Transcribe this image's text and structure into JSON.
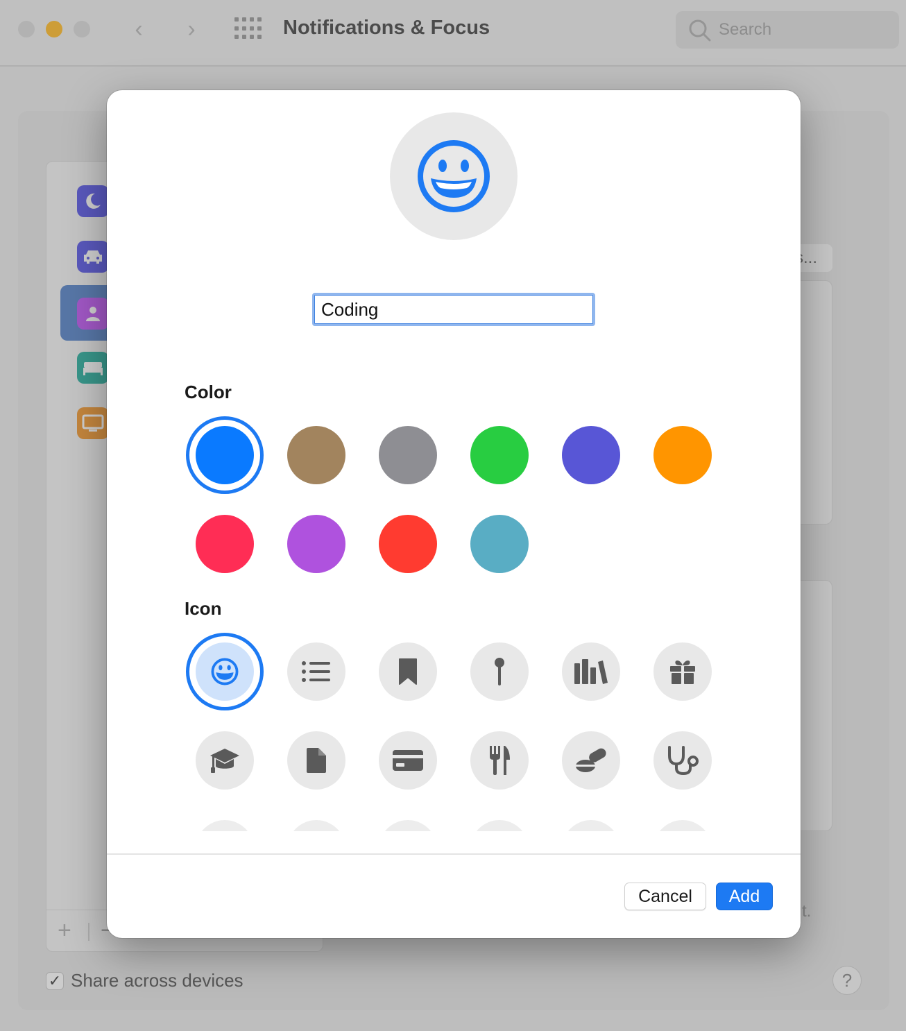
{
  "window": {
    "title": "Notifications & Focus",
    "search_placeholder": "Search"
  },
  "background": {
    "sidebar_focus_items": [
      {
        "icon": "moon-icon",
        "color": "#5e5ce6"
      },
      {
        "icon": "car-icon",
        "color": "#5e5ce6"
      },
      {
        "icon": "person-icon",
        "color": "#bf5af2"
      },
      {
        "icon": "bed-icon",
        "color": "#30b0a0"
      },
      {
        "icon": "tv-icon",
        "color": "#f09a37"
      }
    ],
    "options_button_label": "s...",
    "footer_trailing_text": "t.",
    "share_checkbox_checked": true,
    "share_label": "Share across devices",
    "help_label": "?"
  },
  "sheet": {
    "preview_icon": "smiley-icon",
    "accent_color": "#1d7af3",
    "name_value": "Coding",
    "color_label": "Color",
    "icon_label": "Icon",
    "selected_color_index": 0,
    "colors": [
      "#0a7aff",
      "#a2845e",
      "#8e8e93",
      "#28cd41",
      "#5856d6",
      "#ff9500",
      "#ff2d55",
      "#af52de",
      "#ff3b30",
      "#59adc4"
    ],
    "selected_icon_index": 0,
    "icons": [
      "smiley-icon",
      "list-icon",
      "bookmark-icon",
      "pin-icon",
      "books-icon",
      "gift-icon",
      "graduation-cap-icon",
      "document-icon",
      "credit-card-icon",
      "fork-knife-icon",
      "pills-icon",
      "stethoscope-icon"
    ],
    "cancel_label": "Cancel",
    "add_label": "Add"
  }
}
